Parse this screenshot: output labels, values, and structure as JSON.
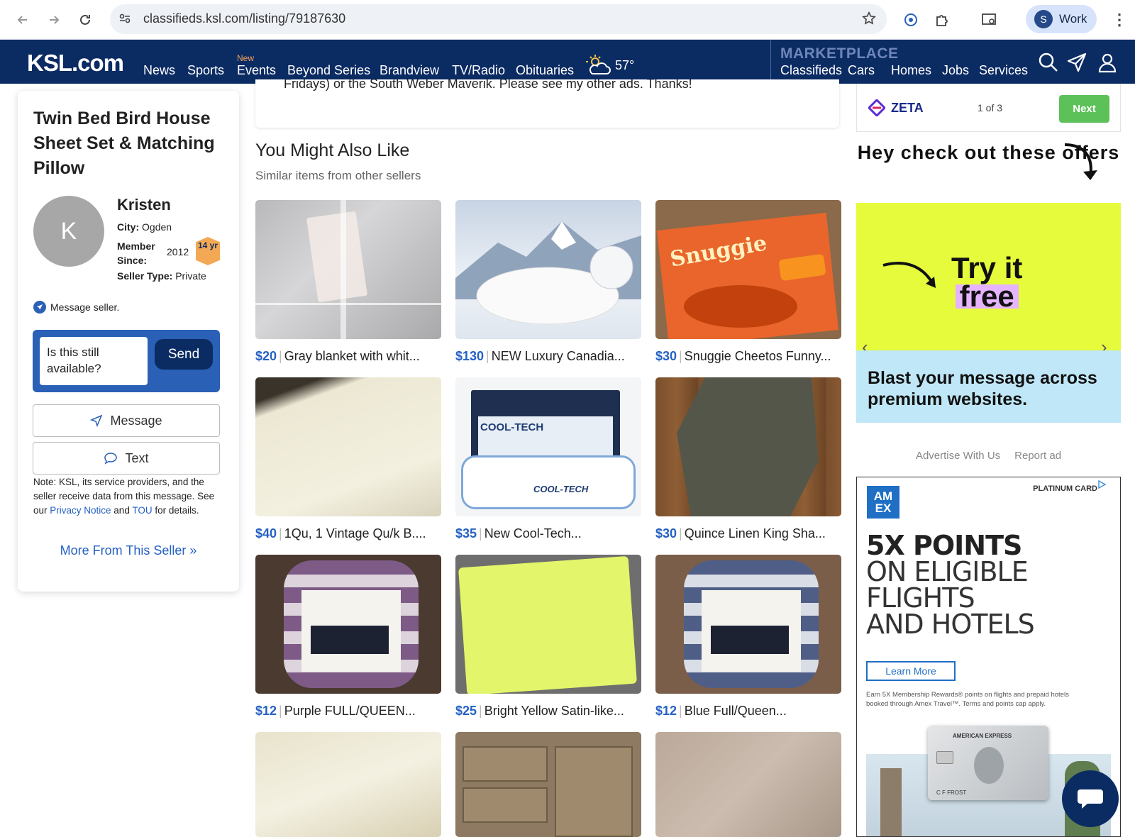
{
  "browser": {
    "url": "classifieds.ksl.com/listing/79187630",
    "profile_initial": "S",
    "profile_label": "Work"
  },
  "nav": {
    "logo": "KSL.com",
    "links": [
      "News",
      "Sports",
      "Events",
      "Beyond Series",
      "Brandview",
      "TV/Radio",
      "Obituaries"
    ],
    "new_tag": "New",
    "weather_temp": "57°",
    "marketplace_label": "MARKETPLACE",
    "marketplace_links": [
      "Classifieds",
      "Cars",
      "Homes",
      "Jobs",
      "Services"
    ]
  },
  "listing": {
    "title": "Twin Bed Bird House Sheet Set & Matching Pillow",
    "description_tail": "Fridays) or the South Weber Maverik. Please see my other ads. Thanks!"
  },
  "seller": {
    "initial": "K",
    "name": "Kristen",
    "city_label": "City:",
    "city": "Ogden",
    "member_label": "Member Since:",
    "member_since": "2012",
    "years_badge": "14 yr",
    "type_label": "Seller Type:",
    "type": "Private",
    "message_seller": "Message seller.",
    "message_text": "Is this still available?",
    "send": "Send",
    "message_btn": "Message",
    "text_btn": "Text",
    "note_pre": "Note: KSL, its service providers, and the seller receive data from this message. See our ",
    "privacy": "Privacy Notice",
    "and": " and ",
    "tou": "TOU",
    "note_post": " for details.",
    "more_from": "More From This Seller »"
  },
  "similar": {
    "title": "You Might Also Like",
    "subtitle": "Similar items from other sellers",
    "items": [
      {
        "price": "$20",
        "name": "Gray blanket with whit..."
      },
      {
        "price": "$130",
        "name": "NEW Luxury Canadia..."
      },
      {
        "price": "$30",
        "name": "Snuggie Cheetos Funny..."
      },
      {
        "price": "$40",
        "name": "1Qu, 1 Vintage Qu/k B...."
      },
      {
        "price": "$35",
        "name": "New Cool-Tech..."
      },
      {
        "price": "$30",
        "name": "Quince Linen King Sha..."
      },
      {
        "price": "$12",
        "name": "Purple FULL/QUEEN..."
      },
      {
        "price": "$25",
        "name": "Bright Yellow Satin-like..."
      },
      {
        "price": "$12",
        "name": "Blue Full/Queen..."
      },
      {
        "price": "",
        "name": ""
      },
      {
        "price": "",
        "name": ""
      },
      {
        "price": "",
        "name": ""
      }
    ]
  },
  "ads": {
    "zeta_brand": "ZETA",
    "zeta_count": "1 of 3",
    "zeta_next": "Next",
    "zeta_head": "Hey check out these offers",
    "zeta_try": "Try it",
    "zeta_free": "free",
    "zeta_blast": "Blast your message across premium websites.",
    "advertise": "Advertise With Us",
    "report": "Report ad",
    "amex_tag": "PLATINUM CARD",
    "amex_logo": "AM EX",
    "amex_head1": "5X POINTS",
    "amex_head2": "ON ELIGIBLE",
    "amex_head3": "FLIGHTS",
    "amex_head4": "AND HOTELS",
    "amex_learn": "Learn More",
    "amex_fine": "Earn 5X Membership Rewards® points on flights and prepaid hotels booked through Amex Travel™. Terms and points cap apply.",
    "amex_card_name": "AMERICAN EXPRESS",
    "amex_card_holder": "C F FROST"
  },
  "colors": {
    "nav_bg": "#0b2b63",
    "link_blue": "#2461c4",
    "lime": "#e6fb3b",
    "zeta_green": "#5dc15a"
  }
}
